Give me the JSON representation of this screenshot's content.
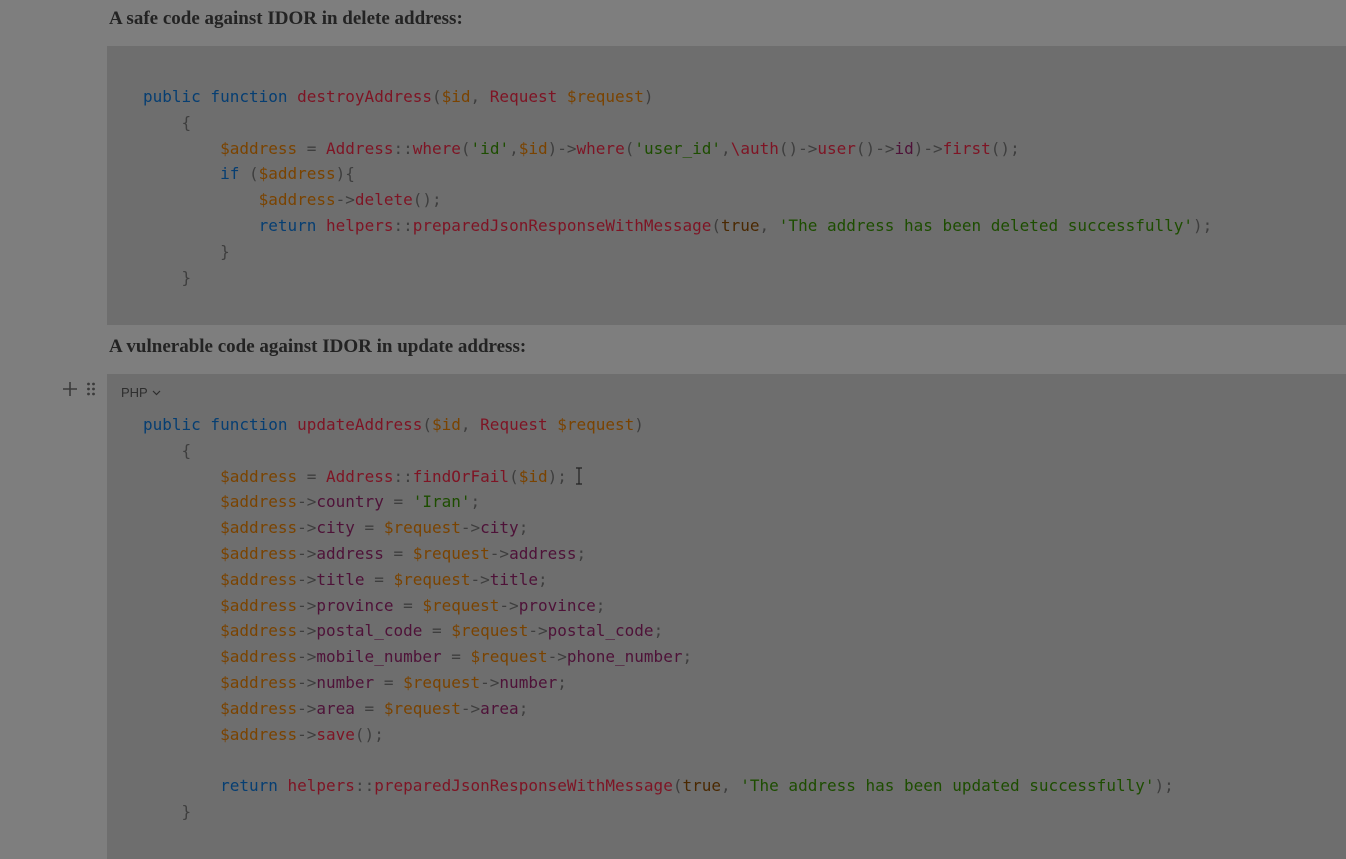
{
  "section1": {
    "heading": "A safe code against IDOR in delete address:"
  },
  "section2": {
    "heading": "A vulnerable code against IDOR in update address:",
    "language_selector": "PHP"
  },
  "code1": [
    [
      [
        "k",
        "public function "
      ],
      [
        "f",
        "destroyAddress"
      ],
      [
        "pu",
        "("
      ],
      [
        "v",
        "$id"
      ],
      [
        "pu",
        ", "
      ],
      [
        "f",
        "Request "
      ],
      [
        "v",
        "$request"
      ],
      [
        "pu",
        ")"
      ]
    ],
    [
      [
        "pu",
        "    {"
      ]
    ],
    [
      [
        "pu",
        "        "
      ],
      [
        "v",
        "$address"
      ],
      [
        "pu",
        " = "
      ],
      [
        "f",
        "Address"
      ],
      [
        "pu",
        "::"
      ],
      [
        "f",
        "where"
      ],
      [
        "pu",
        "("
      ],
      [
        "s",
        "'id'"
      ],
      [
        "pu",
        ","
      ],
      [
        "v",
        "$id"
      ],
      [
        "pu",
        ")->"
      ],
      [
        "f",
        "where"
      ],
      [
        "pu",
        "("
      ],
      [
        "s",
        "'user_id'"
      ],
      [
        "pu",
        ","
      ],
      [
        "f",
        "\\auth"
      ],
      [
        "pu",
        "()->"
      ],
      [
        "f",
        "user"
      ],
      [
        "pu",
        "()->"
      ],
      [
        "p",
        "id"
      ],
      [
        "pu",
        ")->"
      ],
      [
        "f",
        "first"
      ],
      [
        "pu",
        "();"
      ]
    ],
    [
      [
        "pu",
        "        "
      ],
      [
        "k",
        "if "
      ],
      [
        "pu",
        "("
      ],
      [
        "v",
        "$address"
      ],
      [
        "pu",
        "){"
      ]
    ],
    [
      [
        "pu",
        "            "
      ],
      [
        "v",
        "$address"
      ],
      [
        "pu",
        "->"
      ],
      [
        "f",
        "delete"
      ],
      [
        "pu",
        "();"
      ]
    ],
    [
      [
        "pu",
        "            "
      ],
      [
        "k",
        "return "
      ],
      [
        "f",
        "helpers"
      ],
      [
        "pu",
        "::"
      ],
      [
        "f",
        "preparedJsonResponseWithMessage"
      ],
      [
        "pu",
        "("
      ],
      [
        "b",
        "true"
      ],
      [
        "pu",
        ", "
      ],
      [
        "s",
        "'The address has been deleted successfully'"
      ],
      [
        "pu",
        ");"
      ]
    ],
    [
      [
        "pu",
        "        }"
      ]
    ],
    [
      [
        "pu",
        "    }"
      ]
    ]
  ],
  "code2": [
    [
      [
        "k",
        "public function "
      ],
      [
        "f",
        "updateAddress"
      ],
      [
        "pu",
        "("
      ],
      [
        "v",
        "$id"
      ],
      [
        "pu",
        ", "
      ],
      [
        "f",
        "Request "
      ],
      [
        "v",
        "$request"
      ],
      [
        "pu",
        ")"
      ]
    ],
    [
      [
        "pu",
        "    {"
      ]
    ],
    [
      [
        "pu",
        "        "
      ],
      [
        "v",
        "$address"
      ],
      [
        "pu",
        " = "
      ],
      [
        "f",
        "Address"
      ],
      [
        "pu",
        "::"
      ],
      [
        "f",
        "findOrFail"
      ],
      [
        "pu",
        "("
      ],
      [
        "v",
        "$id"
      ],
      [
        "pu",
        ");"
      ]
    ],
    [
      [
        "pu",
        "        "
      ],
      [
        "v",
        "$address"
      ],
      [
        "pu",
        "->"
      ],
      [
        "p",
        "country"
      ],
      [
        "pu",
        " = "
      ],
      [
        "s",
        "'Iran'"
      ],
      [
        "pu",
        ";"
      ]
    ],
    [
      [
        "pu",
        "        "
      ],
      [
        "v",
        "$address"
      ],
      [
        "pu",
        "->"
      ],
      [
        "p",
        "city"
      ],
      [
        "pu",
        " = "
      ],
      [
        "v",
        "$request"
      ],
      [
        "pu",
        "->"
      ],
      [
        "p",
        "city"
      ],
      [
        "pu",
        ";"
      ]
    ],
    [
      [
        "pu",
        "        "
      ],
      [
        "v",
        "$address"
      ],
      [
        "pu",
        "->"
      ],
      [
        "p",
        "address"
      ],
      [
        "pu",
        " = "
      ],
      [
        "v",
        "$request"
      ],
      [
        "pu",
        "->"
      ],
      [
        "p",
        "address"
      ],
      [
        "pu",
        ";"
      ]
    ],
    [
      [
        "pu",
        "        "
      ],
      [
        "v",
        "$address"
      ],
      [
        "pu",
        "->"
      ],
      [
        "p",
        "title"
      ],
      [
        "pu",
        " = "
      ],
      [
        "v",
        "$request"
      ],
      [
        "pu",
        "->"
      ],
      [
        "p",
        "title"
      ],
      [
        "pu",
        ";"
      ]
    ],
    [
      [
        "pu",
        "        "
      ],
      [
        "v",
        "$address"
      ],
      [
        "pu",
        "->"
      ],
      [
        "p",
        "province"
      ],
      [
        "pu",
        " = "
      ],
      [
        "v",
        "$request"
      ],
      [
        "pu",
        "->"
      ],
      [
        "p",
        "province"
      ],
      [
        "pu",
        ";"
      ]
    ],
    [
      [
        "pu",
        "        "
      ],
      [
        "v",
        "$address"
      ],
      [
        "pu",
        "->"
      ],
      [
        "p",
        "postal_code"
      ],
      [
        "pu",
        " = "
      ],
      [
        "v",
        "$request"
      ],
      [
        "pu",
        "->"
      ],
      [
        "p",
        "postal_code"
      ],
      [
        "pu",
        ";"
      ]
    ],
    [
      [
        "pu",
        "        "
      ],
      [
        "v",
        "$address"
      ],
      [
        "pu",
        "->"
      ],
      [
        "p",
        "mobile_number"
      ],
      [
        "pu",
        " = "
      ],
      [
        "v",
        "$request"
      ],
      [
        "pu",
        "->"
      ],
      [
        "p",
        "phone_number"
      ],
      [
        "pu",
        ";"
      ]
    ],
    [
      [
        "pu",
        "        "
      ],
      [
        "v",
        "$address"
      ],
      [
        "pu",
        "->"
      ],
      [
        "p",
        "number"
      ],
      [
        "pu",
        " = "
      ],
      [
        "v",
        "$request"
      ],
      [
        "pu",
        "->"
      ],
      [
        "p",
        "number"
      ],
      [
        "pu",
        ";"
      ]
    ],
    [
      [
        "pu",
        "        "
      ],
      [
        "v",
        "$address"
      ],
      [
        "pu",
        "->"
      ],
      [
        "p",
        "area"
      ],
      [
        "pu",
        " = "
      ],
      [
        "v",
        "$request"
      ],
      [
        "pu",
        "->"
      ],
      [
        "p",
        "area"
      ],
      [
        "pu",
        ";"
      ]
    ],
    [
      [
        "pu",
        "        "
      ],
      [
        "v",
        "$address"
      ],
      [
        "pu",
        "->"
      ],
      [
        "f",
        "save"
      ],
      [
        "pu",
        "();"
      ]
    ],
    [
      [
        "pu",
        ""
      ]
    ],
    [
      [
        "pu",
        "        "
      ],
      [
        "k",
        "return "
      ],
      [
        "f",
        "helpers"
      ],
      [
        "pu",
        "::"
      ],
      [
        "f",
        "preparedJsonResponseWithMessage"
      ],
      [
        "pu",
        "("
      ],
      [
        "b",
        "true"
      ],
      [
        "pu",
        ", "
      ],
      [
        "s",
        "'The address has been updated successfully'"
      ],
      [
        "pu",
        ");"
      ]
    ],
    [
      [
        "pu",
        "    }"
      ]
    ]
  ]
}
